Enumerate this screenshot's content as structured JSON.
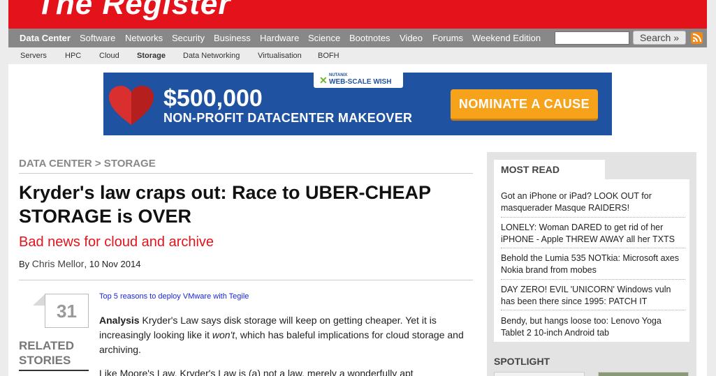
{
  "site": {
    "logo_text": "The Register"
  },
  "nav": {
    "items": [
      {
        "label": "Data Center",
        "active": true
      },
      {
        "label": "Software"
      },
      {
        "label": "Networks"
      },
      {
        "label": "Security"
      },
      {
        "label": "Business"
      },
      {
        "label": "Hardware"
      },
      {
        "label": "Science"
      },
      {
        "label": "Bootnotes"
      },
      {
        "label": "Video"
      },
      {
        "label": "Forums"
      },
      {
        "label": "Weekend Edition"
      }
    ],
    "search": {
      "value": "",
      "button_label": "Search »"
    },
    "icons": {
      "rss": "rss-icon"
    }
  },
  "subnav": {
    "items": [
      {
        "label": "Servers"
      },
      {
        "label": "HPC"
      },
      {
        "label": "Cloud"
      },
      {
        "label": "Storage",
        "active": true
      },
      {
        "label": "Data Networking"
      },
      {
        "label": "Virtualisation"
      },
      {
        "label": "BOFH"
      }
    ]
  },
  "banner": {
    "brand_tag": "NUTANIX",
    "brand_text": "WEB-SCALE WISH",
    "amount": "$500,000",
    "subtitle": "NON-PROFIT DATACENTER MAKEOVER",
    "cta": "NOMINATE A CAUSE",
    "icon": "heart-icon"
  },
  "article": {
    "breadcrumb": "DATA CENTER > STORAGE",
    "headline": "Kryder's law craps out: Race to UBER-CHEAP STORAGE is OVER",
    "standfirst": "Bad news for cloud and archive",
    "byline_prefix": "By ",
    "author": "Chris Mellor",
    "date": ", 10 Nov 2014",
    "comment_count": "31",
    "related_title": "RELATED STORIES",
    "sponsor_link": "Top 5 reasons to deploy VMware with Tegile",
    "para1_lead": "Analysis",
    "para1_a": " Kryder's Law says disk storage will keep on getting cheaper. Yet it is increasingly looking like it ",
    "para1_em": "won't",
    "para1_b": ", which has baleful implications for cloud storage and archiving.",
    "para2": "Like Moore's Law, Kryder's Law is (a) not a law, merely a wonderfully apt"
  },
  "sidebar": {
    "most_read_title": "MOST READ",
    "most_read": [
      "Got an iPhone or iPad? LOOK OUT for masquerader Masque RAIDERS!",
      "LONELY: Woman DARED to get rid of her iPHONE - Apple THREW AWAY all her TXTS",
      "Behold the Lumia 535 NOTkia: Microsoft axes Nokia brand from mobes",
      "DAY ZERO! EVIL 'UNICORN' Windows vuln has been there since 1995: PATCH IT",
      "Bendy, but hangs loose too: Lenovo Yoga Tablet 2 10-inch Android tab"
    ],
    "spotlight_title": "SPOTLIGHT"
  },
  "colors": {
    "brand_red": "#e4121b",
    "nav_grey": "#888888",
    "banner_blue": "#1f52a0",
    "cta_orange": "#f6a21a",
    "link_blue": "#1a26d6"
  }
}
